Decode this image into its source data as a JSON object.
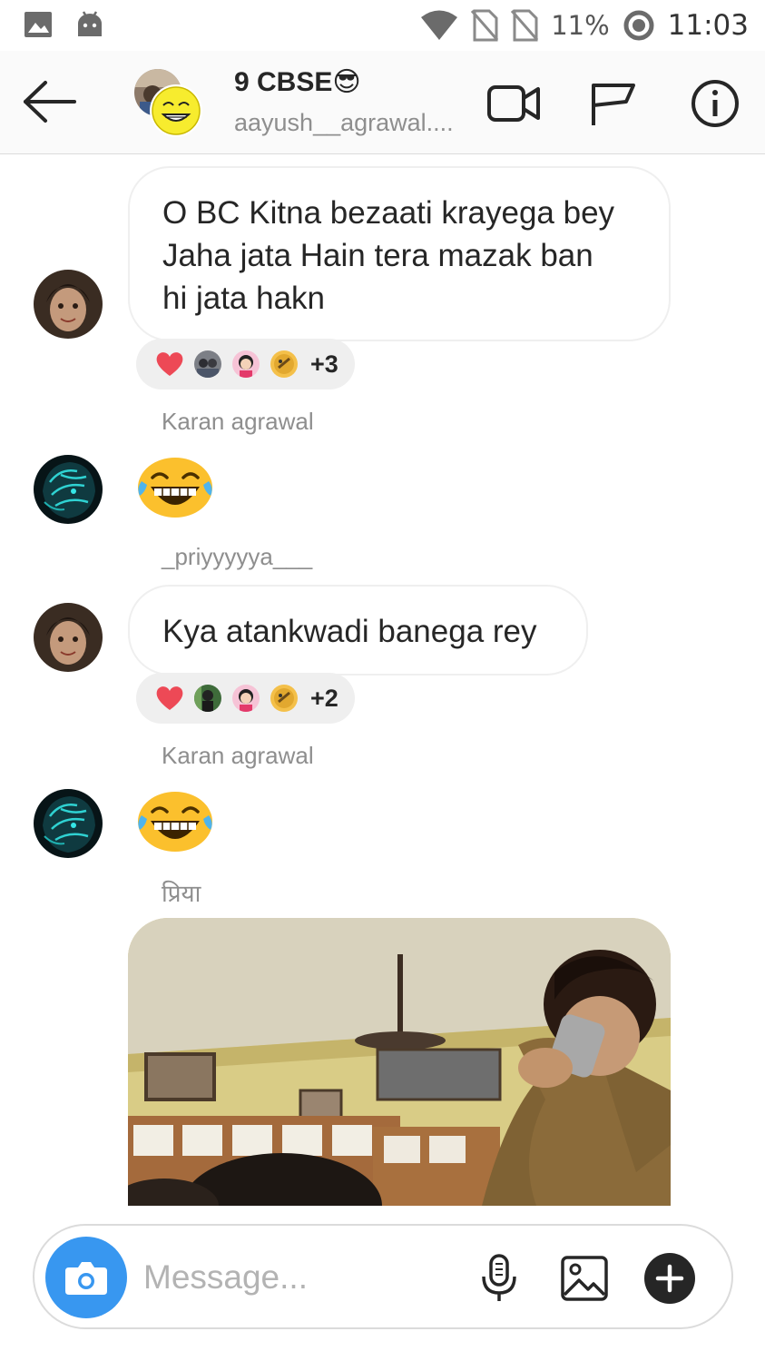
{
  "status_bar": {
    "battery": "11%",
    "time": "11:03",
    "icons": [
      "gallery-icon",
      "android-icon",
      "wifi-icon",
      "no-sim-icon",
      "no-sim-icon",
      "battery-saver-icon"
    ]
  },
  "header": {
    "title": "9 CBSE😎",
    "subtitle": "aayush__agrawal....",
    "icons": [
      "back-arrow-icon",
      "video-call-icon",
      "flag-icon",
      "info-icon"
    ]
  },
  "messages": [
    {
      "type": "text",
      "text_lines": [
        "O BC Kitna bezaati krayega bey",
        "Jaha jata Hain tera mazak ban",
        "hi jata hakn"
      ],
      "reactions": {
        "emoji": "heart-icon",
        "count": "+3"
      }
    },
    {
      "type": "sender",
      "name": "Karan agrawal"
    },
    {
      "type": "emoji",
      "emoji": "laughing-tears-emoji"
    },
    {
      "type": "sender",
      "name": "_priyyyyya___"
    },
    {
      "type": "text",
      "text": "Kya atankwadi banega rey",
      "reactions": {
        "emoji": "heart-icon",
        "count": "+2"
      }
    },
    {
      "type": "sender",
      "name": "Karan agrawal"
    },
    {
      "type": "emoji",
      "emoji": "laughing-tears-emoji"
    },
    {
      "type": "sender",
      "name": "प्रिया"
    },
    {
      "type": "gif"
    }
  ],
  "composer": {
    "placeholder": "Message...",
    "icons": [
      "camera-icon",
      "microphone-icon",
      "image-icon",
      "plus-icon"
    ]
  },
  "colors": {
    "accent_blue": "#3897f0",
    "heart": "#ed4956",
    "emoji_yellow": "#fbc02d"
  }
}
